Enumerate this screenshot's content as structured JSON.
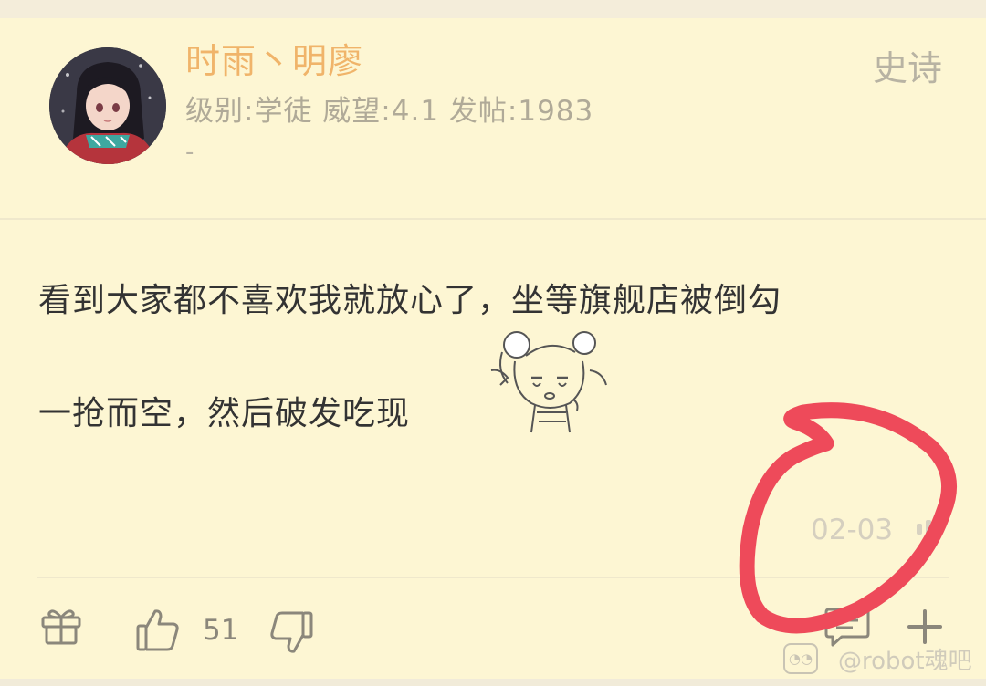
{
  "post": {
    "author": {
      "name": "时雨丶明廖",
      "meta": "级别:学徒 威望:4.1 发帖:1983",
      "signature": "-"
    },
    "floor_tag": "史诗",
    "content_line1": "看到大家都不喜欢我就放心了，坐等旗舰店被倒勾",
    "content_line2": "一抢而空，然后破发吃现",
    "time": "02-03",
    "like_count": "51"
  },
  "watermark": {
    "text": "@robot魂吧"
  },
  "colors": {
    "background": "#fdf6d3",
    "author_name": "#f0b46a",
    "annotation_circle": "#ee4a5a"
  },
  "icons": {
    "gift": "gift-icon",
    "like": "thumbs-up-icon",
    "dislike": "thumbs-down-icon",
    "reply": "comment-icon",
    "add": "plus-icon",
    "more": "more-icon"
  }
}
